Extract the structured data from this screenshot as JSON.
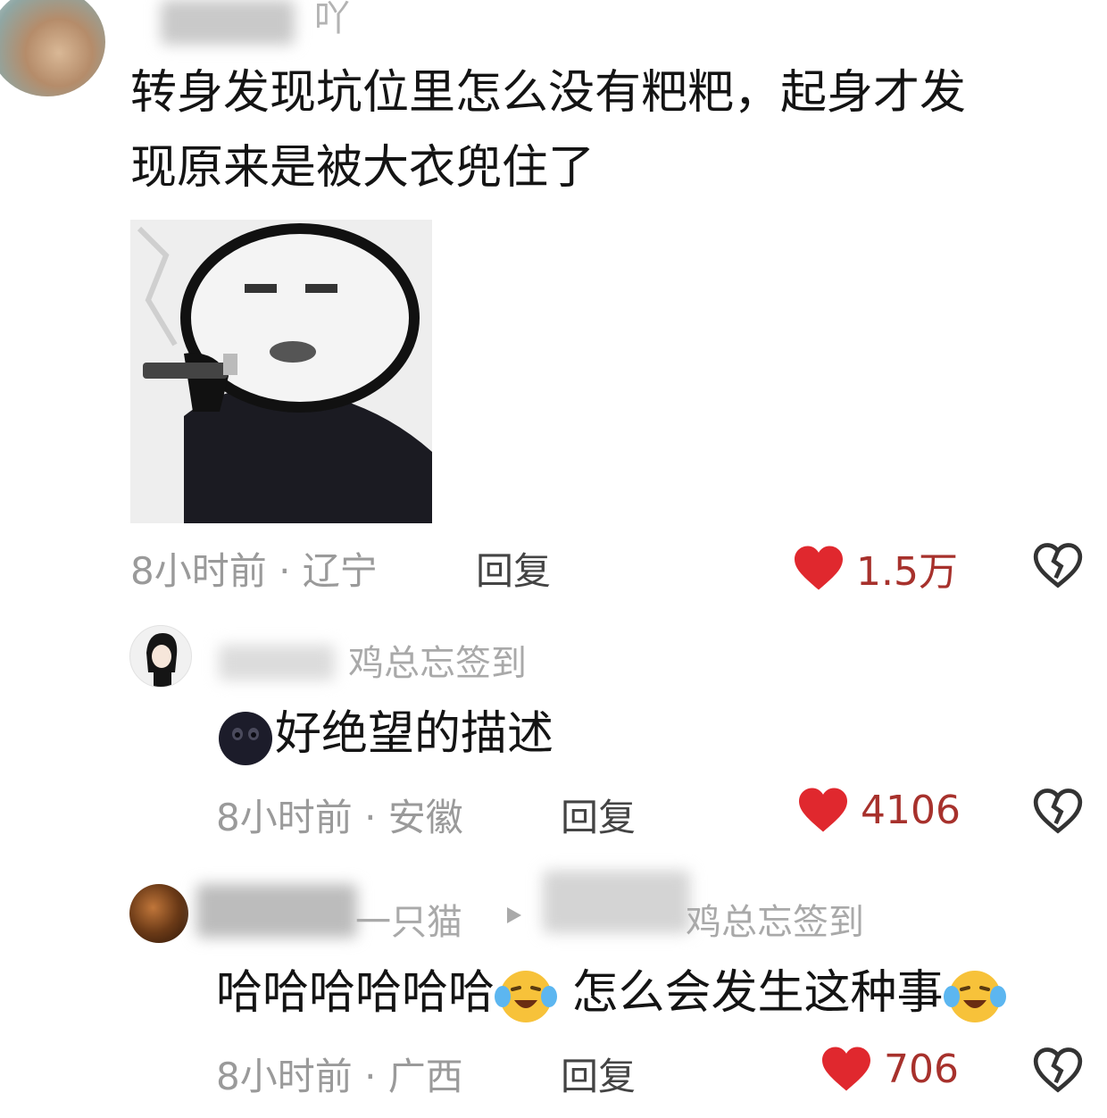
{
  "comments": [
    {
      "username_visible": "吖",
      "text_line1": "转身发现坑位里怎么没有粑粑，起身才发",
      "text_line2": "现原来是被大衣兜住了",
      "time": "8小时前",
      "location": "辽宁",
      "reply_label": "回复",
      "likes": "1.5万"
    },
    {
      "username_visible": "鸡总忘签到",
      "text": "好绝望的描述",
      "time": "8小时前",
      "location": "安徽",
      "reply_label": "回复",
      "likes": "4106"
    },
    {
      "username_visible": "一只猫",
      "reply_target": "鸡总忘签到",
      "text_part1": "哈哈哈哈哈哈",
      "text_part2": "怎么会发生这种事",
      "time": "8小时前",
      "location": "广西",
      "reply_label": "回复",
      "likes": "706"
    }
  ],
  "meta_separator": " · ",
  "icons": {
    "like": "heart-icon",
    "dislike": "broken-heart-icon",
    "emoji_dark": "black-blob-emoji-icon",
    "emoji_laugh_cry": "laugh-cry-emoji-icon",
    "reply_arrow": "triangle-right-icon"
  },
  "colors": {
    "heart": "#e0282e",
    "like_count": "#a7312c",
    "meta": "#9a9a9a"
  }
}
